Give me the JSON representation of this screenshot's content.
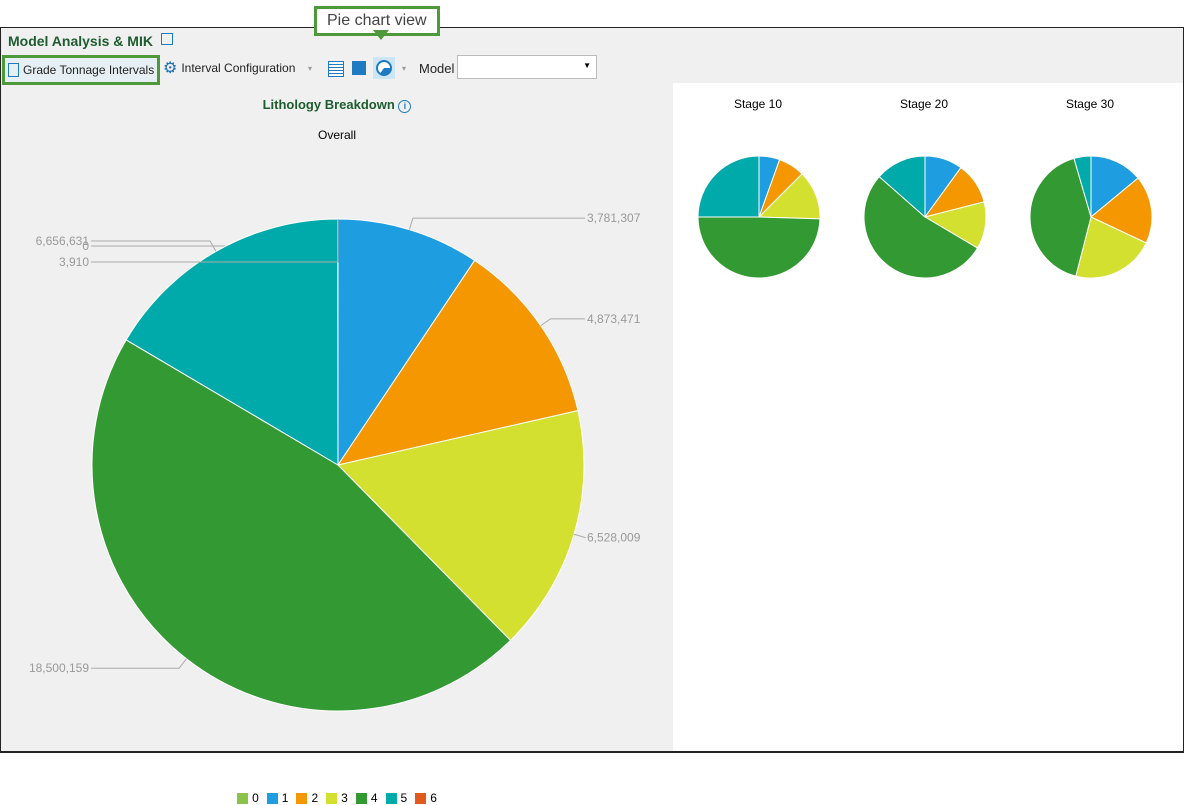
{
  "app_title": "Model Analysis & MIK",
  "tooltip": "Pie chart view",
  "toolbar": {
    "grade_tonnage": "Grade Tonnage Intervals",
    "interval_config": "Interval Configuration",
    "model_label": "Model",
    "model_value": ""
  },
  "colors": {
    "0": "#8bc34a",
    "1": "#1e9de0",
    "2": "#f49700",
    "3": "#d4e030",
    "4": "#339933",
    "5": "#00aaaa",
    "6": "#e05a1e"
  },
  "chart_data": [
    {
      "type": "pie",
      "title": "Lithology Breakdown",
      "subtitle": "Overall",
      "categories": [
        "0",
        "1",
        "2",
        "3",
        "4",
        "5",
        "6"
      ],
      "values": [
        0,
        3781307,
        4873471,
        6528009,
        18500159,
        6656631,
        3910
      ],
      "labels": [
        "0",
        "3,781,307",
        "4,873,471",
        "6,528,009",
        "18,500,159",
        "6,656,631",
        "3,910"
      ],
      "legend": "bottom"
    },
    {
      "type": "pie",
      "title": "Stage 10",
      "categories": [
        "1",
        "2",
        "3",
        "4",
        "5"
      ],
      "values": [
        5.5,
        7,
        13,
        49.5,
        25
      ]
    },
    {
      "type": "pie",
      "title": "Stage 20",
      "categories": [
        "1",
        "2",
        "3",
        "4",
        "5"
      ],
      "values": [
        10,
        11,
        12.5,
        53,
        13.5
      ]
    },
    {
      "type": "pie",
      "title": "Stage 30",
      "categories": [
        "1",
        "2",
        "3",
        "4",
        "5"
      ],
      "values": [
        14,
        18,
        22,
        41.5,
        4.5
      ]
    }
  ]
}
